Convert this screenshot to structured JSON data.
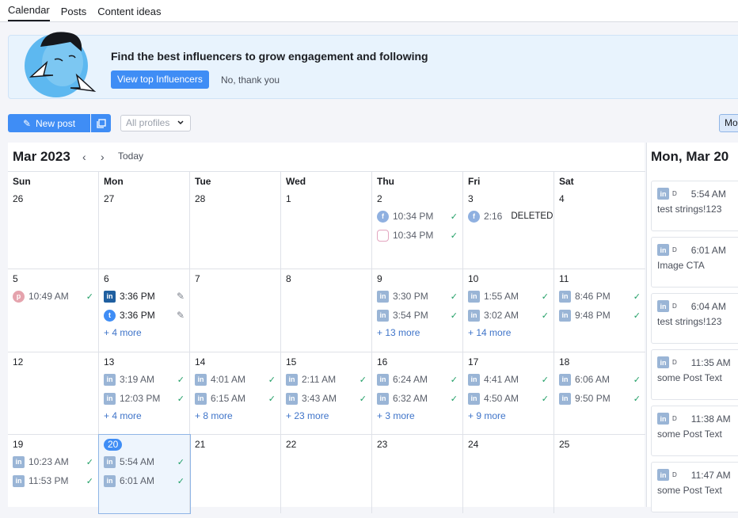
{
  "tabs": [
    "Calendar",
    "Posts",
    "Content ideas"
  ],
  "banner": {
    "headline": "Find the best influencers to grow engagement and following",
    "primary": "View top Influencers",
    "secondary": "No, thank you"
  },
  "toolbar": {
    "new_post": "New post",
    "profiles": "All profiles",
    "mode": "Mo"
  },
  "calendar": {
    "title": "Mar 2023",
    "prev": "‹",
    "next": "›",
    "today": "Today",
    "dow": [
      "Sun",
      "Mon",
      "Tue",
      "Wed",
      "Thu",
      "Fri",
      "Sat"
    ],
    "week1": {
      "d": [
        "26",
        "27",
        "28",
        "1",
        "2",
        "3",
        "4"
      ],
      "thu": [
        {
          "time": "10:34 PM"
        },
        {
          "time": "10:34 PM"
        }
      ],
      "fri": {
        "time": "2:16",
        "status": "DELETED"
      }
    },
    "week2": {
      "d": [
        "5",
        "6",
        "7",
        "8",
        "9",
        "10",
        "11"
      ],
      "sun": {
        "time": "10:49 AM"
      },
      "mon": [
        {
          "time": "3:36 PM"
        },
        {
          "time": "3:36 PM"
        }
      ],
      "mon_more": "+ 4 more",
      "thu": [
        {
          "time": "3:30 PM"
        },
        {
          "time": "3:54 PM"
        }
      ],
      "thu_more": "+ 13 more",
      "fri": [
        {
          "time": "1:55 AM"
        },
        {
          "time": "3:02 AM"
        }
      ],
      "fri_more": "+ 14 more",
      "sat": [
        {
          "time": "8:46 PM"
        },
        {
          "time": "9:48 PM"
        }
      ]
    },
    "week3": {
      "d": [
        "12",
        "13",
        "14",
        "15",
        "16",
        "17",
        "18"
      ],
      "mon": [
        {
          "time": "3:19 AM"
        },
        {
          "time": "12:03 PM"
        }
      ],
      "mon_more": "+ 4 more",
      "tue": [
        {
          "time": "4:01 AM"
        },
        {
          "time": "6:15 AM"
        }
      ],
      "tue_more": "+ 8 more",
      "wed": [
        {
          "time": "2:11 AM"
        },
        {
          "time": "3:43 AM"
        }
      ],
      "wed_more": "+ 23 more",
      "thu": [
        {
          "time": "6:24 AM"
        },
        {
          "time": "6:32 AM"
        }
      ],
      "thu_more": "+ 3 more",
      "fri": [
        {
          "time": "4:41 AM"
        },
        {
          "time": "4:50 AM"
        }
      ],
      "fri_more": "+ 9 more",
      "sat": [
        {
          "time": "6:06 AM"
        },
        {
          "time": "9:50 PM"
        }
      ]
    },
    "week4": {
      "d": [
        "19",
        "20",
        "21",
        "22",
        "23",
        "24",
        "25"
      ],
      "sun": [
        {
          "time": "10:23 AM"
        },
        {
          "time": "11:53 PM"
        }
      ],
      "mon": [
        {
          "time": "5:54 AM"
        },
        {
          "time": "6:01 AM"
        }
      ]
    }
  },
  "side": {
    "title": "Mon, Mar 20",
    "items": [
      {
        "time": "5:54 AM",
        "text": "test strings!123"
      },
      {
        "time": "6:01 AM",
        "text": "Image CTA"
      },
      {
        "time": "6:04 AM",
        "text": "test strings!123"
      },
      {
        "time": "11:35 AM",
        "text": "some Post Text"
      },
      {
        "time": "11:38 AM",
        "text": "some Post Text"
      },
      {
        "time": "11:47 AM",
        "text": "some Post Text"
      }
    ]
  },
  "icons": {
    "linkedin": "in",
    "linkedin_badge": "D",
    "check": "✓",
    "pencil": "✎"
  }
}
